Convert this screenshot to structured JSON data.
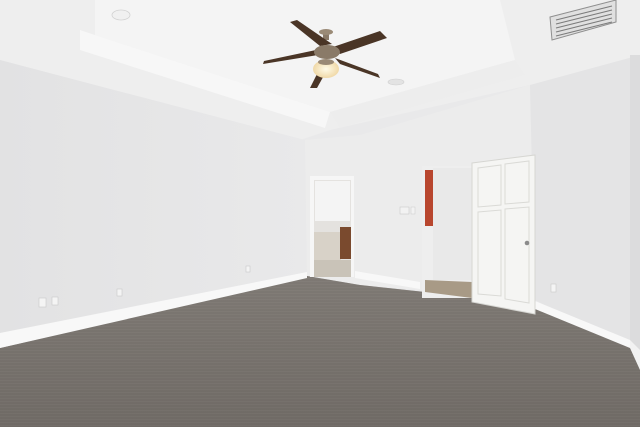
{
  "scene": {
    "description_visible_text": [],
    "palette": {
      "ceiling": "#efefef",
      "tray_ceiling": "#f5f5f5",
      "wall_left": "#e6e6e7",
      "wall_back": "#ececec",
      "wall_right": "#e3e3e4",
      "carpet": "#7a7570",
      "baseboard": "#f7f7f7",
      "door": "#f4f4f2",
      "accent_wall": "#b8462e",
      "cabinet": "#7a4a2e",
      "fan_blade": "#4a3526",
      "fan_metal": "#8a7a68",
      "light_glow": "#fff3d6"
    }
  }
}
